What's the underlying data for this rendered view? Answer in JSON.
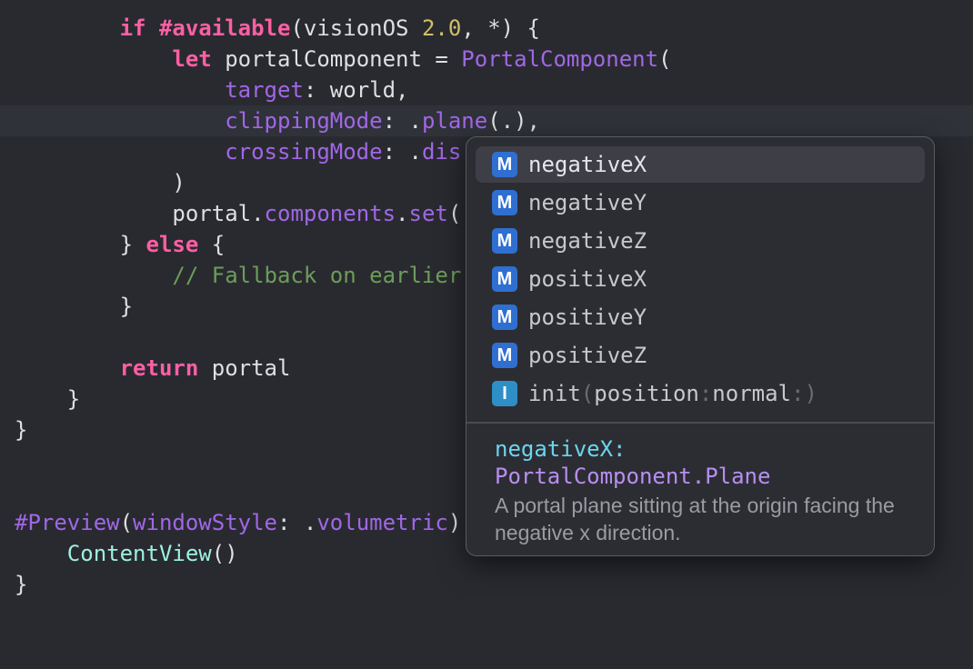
{
  "editor": {
    "lines": [
      {
        "indent": "        ",
        "tokens": [
          [
            "kw",
            "if"
          ],
          [
            "plain",
            " "
          ],
          [
            "kw",
            "#available"
          ],
          [
            "plain",
            "(visionOS "
          ],
          [
            "num",
            "2.0"
          ],
          [
            "plain",
            ", *) {"
          ]
        ]
      },
      {
        "indent": "            ",
        "tokens": [
          [
            "kw",
            "let"
          ],
          [
            "plain",
            " portalComponent = "
          ],
          [
            "fn",
            "PortalComponent"
          ],
          [
            "plain",
            "("
          ]
        ]
      },
      {
        "indent": "                ",
        "tokens": [
          [
            "prop",
            "target"
          ],
          [
            "plain",
            ": world,"
          ]
        ]
      },
      {
        "indent": "                ",
        "tokens": [
          [
            "prop",
            "clippingMode"
          ],
          [
            "plain",
            ": ."
          ],
          [
            "prop",
            "plane"
          ],
          [
            "plain",
            "(.),"
          ]
        ]
      },
      {
        "indent": "                ",
        "tokens": [
          [
            "prop",
            "crossingMode"
          ],
          [
            "plain",
            ": ."
          ],
          [
            "prop",
            "dis"
          ]
        ]
      },
      {
        "indent": "            ",
        "tokens": [
          [
            "plain",
            ")"
          ]
        ]
      },
      {
        "indent": "            ",
        "tokens": [
          [
            "plain",
            "portal."
          ],
          [
            "prop",
            "components"
          ],
          [
            "plain",
            "."
          ],
          [
            "fn",
            "set"
          ],
          [
            "plain",
            "("
          ]
        ]
      },
      {
        "indent": "        ",
        "tokens": [
          [
            "plain",
            "} "
          ],
          [
            "kw",
            "else"
          ],
          [
            "plain",
            " {"
          ]
        ]
      },
      {
        "indent": "            ",
        "tokens": [
          [
            "cmt",
            "// Fallback on earlier"
          ]
        ]
      },
      {
        "indent": "        ",
        "tokens": [
          [
            "plain",
            "}"
          ]
        ]
      },
      {
        "indent": "",
        "tokens": []
      },
      {
        "indent": "        ",
        "tokens": [
          [
            "kw",
            "return"
          ],
          [
            "plain",
            " portal"
          ]
        ]
      },
      {
        "indent": "    ",
        "tokens": [
          [
            "plain",
            "}"
          ]
        ]
      },
      {
        "indent": "",
        "tokens": [
          [
            "plain",
            "}"
          ]
        ]
      },
      {
        "indent": "",
        "tokens": []
      },
      {
        "indent": "",
        "tokens": []
      },
      {
        "indent": "",
        "tokens": [
          [
            "attr",
            "#Preview"
          ],
          [
            "plain",
            "("
          ],
          [
            "prop",
            "windowStyle"
          ],
          [
            "plain",
            ": ."
          ],
          [
            "prop",
            "volumetric"
          ],
          [
            "plain",
            ")"
          ]
        ]
      },
      {
        "indent": "    ",
        "tokens": [
          [
            "type",
            "ContentView"
          ],
          [
            "plain",
            "()"
          ]
        ]
      },
      {
        "indent": "",
        "tokens": [
          [
            "plain",
            "}"
          ]
        ]
      }
    ]
  },
  "autocomplete": {
    "items": [
      {
        "kind": "M",
        "label": "negativeX",
        "selected": true
      },
      {
        "kind": "M",
        "label": "negativeY",
        "selected": false
      },
      {
        "kind": "M",
        "label": "negativeZ",
        "selected": false
      },
      {
        "kind": "M",
        "label": "positiveX",
        "selected": false
      },
      {
        "kind": "M",
        "label": "positiveY",
        "selected": false
      },
      {
        "kind": "M",
        "label": "positiveZ",
        "selected": false
      }
    ],
    "init_item": {
      "kind": "I",
      "name": "init",
      "open_paren": "(",
      "params": [
        "position",
        ":",
        "normal",
        ":"
      ],
      "close_paren": ")"
    },
    "doc": {
      "symbol": "negativeX:",
      "type": "PortalComponent.Plane",
      "description": "A portal plane sitting at the origin facing the negative x direction."
    }
  }
}
